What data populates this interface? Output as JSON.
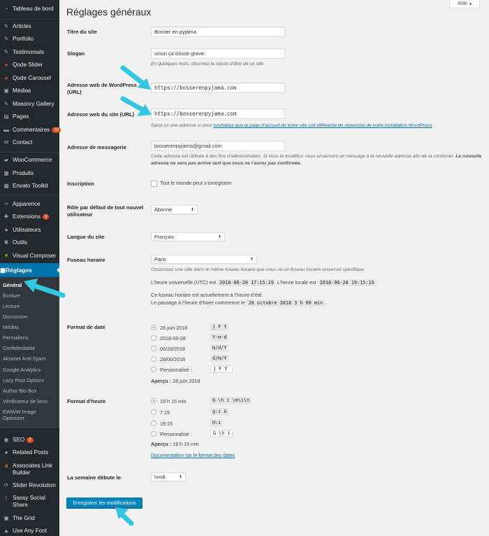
{
  "sidebar": {
    "items": [
      {
        "label": "Tableau de bord",
        "icon": "dashboard-icon",
        "glyph": "◔"
      },
      {
        "label": "Articles",
        "icon": "pin-icon",
        "glyph": "✎"
      },
      {
        "label": "Portfolio",
        "icon": "pin-icon",
        "glyph": "✎"
      },
      {
        "label": "Testimonials",
        "icon": "pin-icon",
        "glyph": "✎"
      },
      {
        "label": "Qode Slider",
        "icon": "qode-icon",
        "glyph": "●"
      },
      {
        "label": "Qode Carousel",
        "icon": "qode-icon",
        "glyph": "●"
      },
      {
        "label": "Médias",
        "icon": "media-icon",
        "glyph": "▣"
      },
      {
        "label": "Masonry Gallery",
        "icon": "pin-icon",
        "glyph": "✎"
      },
      {
        "label": "Pages",
        "icon": "pages-icon",
        "glyph": "▤"
      },
      {
        "label": "Commentaires",
        "icon": "comments-icon",
        "glyph": "▬",
        "badge": "10"
      },
      {
        "label": "Contact",
        "icon": "mail-icon",
        "glyph": "✉"
      },
      {
        "label": "WooCommerce",
        "icon": "woocommerce-icon",
        "glyph": "▰"
      },
      {
        "label": "Produits",
        "icon": "products-icon",
        "glyph": "▦"
      },
      {
        "label": "Envato Toolkit",
        "icon": "toolkit-icon",
        "glyph": "▦"
      },
      {
        "label": "Apparence",
        "icon": "appearance-icon",
        "glyph": "✑"
      },
      {
        "label": "Extensions",
        "icon": "plugins-icon",
        "glyph": "✚",
        "badge": "3"
      },
      {
        "label": "Utilisateurs",
        "icon": "users-icon",
        "glyph": "●"
      },
      {
        "label": "Outils",
        "icon": "tools-icon",
        "glyph": "✖"
      },
      {
        "label": "Visual Composer",
        "icon": "visual-composer-icon",
        "glyph": "▼"
      }
    ],
    "active": {
      "label": "Réglages",
      "icon": "settings-icon",
      "glyph": "▦"
    },
    "submenu": [
      "Général",
      "Écriture",
      "Lecture",
      "Discussion",
      "Médias",
      "Permaliens",
      "Confidentialité",
      "Akismet Anti-Spam",
      "Google Analytics",
      "Lazy Post Options",
      "Author Bio Box",
      "Vérificateur de liens",
      "EWWW Image Optimizer"
    ],
    "bottom_items": [
      {
        "label": "SEO",
        "icon": "seo-icon",
        "glyph": "◉",
        "badge": "3"
      },
      {
        "label": "Related Posts",
        "icon": "related-posts-icon",
        "glyph": "●"
      },
      {
        "label": "Associates Link Builder",
        "icon": "amazon-icon",
        "glyph": "a"
      },
      {
        "label": "Slider Revolution",
        "icon": "slider-icon",
        "glyph": "⟳"
      },
      {
        "label": "Sassy Social Share",
        "icon": "share-icon",
        "glyph": "⟨"
      },
      {
        "label": "The Grid",
        "icon": "grid-icon",
        "glyph": "▣"
      },
      {
        "label": "Use Any Font",
        "icon": "font-icon",
        "glyph": "▲"
      }
    ]
  },
  "header": {
    "title": "Réglages généraux",
    "help": "Aide"
  },
  "form": {
    "site_title": {
      "label": "Titre du site",
      "value": "Bosser en pyjama"
    },
    "tagline": {
      "label": "Slogan",
      "value": "sinon ça bosse grave",
      "desc": "En quelques mots, décrivez la raison d’être de ce site."
    },
    "wp_url": {
      "label": "Adresse web de WordPress (URL)",
      "value": "https://bosserenpyjama.com"
    },
    "site_url": {
      "label": "Adresse web du site (URL)",
      "value": "https://bosserenpyjama.com",
      "desc_pre": "Saisir ici une adresse si vous ",
      "desc_link": "souhaitez que la page d’accueil de votre site soit différente du répertoire de votre installation WordPress",
      "desc_post": "."
    },
    "admin_email": {
      "label": "Adresse de messagerie",
      "value": "bosserenpyjama@gmail.com",
      "desc": "Cette adresse est utilisée à des fins d’administration. Si vous la modifiez, nous enverrons un message à la nouvelle adresse afin de la confirmer.",
      "desc_bold": "La nouvelle adresse ne sera pas active tant que vous ne l’aurez pas confirmée."
    },
    "membership": {
      "label": "Inscription",
      "checkbox_label": "Tout le monde peut s’enregistrer"
    },
    "default_role": {
      "label": "Rôle par défaut de tout nouvel utilisateur",
      "value": "Abonné"
    },
    "language": {
      "label": "Langue du site",
      "value": "Français"
    },
    "timezone": {
      "label": "Fuseau horaire",
      "value": "Paris",
      "desc": "Choisissez une ville dans le même fuseau horaire que vous ou un fuseau horaire universel spécifique.",
      "utc_label": "L’heure universelle (UTC) est",
      "utc_value": "2018-06-28 17:15:19",
      "local_label": "L’heure locale est",
      "local_value": "2018-06-28 19:15:19",
      "dst_line1": "Ce fuseau horaire est actuellement à l’heure d’été.",
      "dst_line2": "Le passage à l’heure d’hiver commence le",
      "dst_value": "28 octobre 2018 3 h 00 min",
      "dst_end": "."
    },
    "date_format": {
      "label": "Format de date",
      "options": [
        {
          "label": "28 juin 2018",
          "code": "j F Y",
          "checked": true
        },
        {
          "label": "2018-06-28",
          "code": "Y-m-d",
          "checked": false
        },
        {
          "label": "06/28/2018",
          "code": "m/d/Y",
          "checked": false
        },
        {
          "label": "28/06/2018",
          "code": "d/m/Y",
          "checked": false
        }
      ],
      "custom_label": "Personnalisé :",
      "custom_value": "j F Y",
      "preview_label": "Aperçu :",
      "preview_value": "28 juin 2018"
    },
    "time_format": {
      "label": "Format d’heure",
      "options": [
        {
          "label": "19 h 15 min",
          "code": "G \\h i \\m\\i\\n",
          "checked": true
        },
        {
          "label": "7:15",
          "code": "g:i A",
          "checked": false
        },
        {
          "label": "19:15",
          "code": "H:i",
          "checked": false
        }
      ],
      "custom_label": "Personnalisé :",
      "custom_value": "G \\h i \\",
      "preview_label": "Aperçu :",
      "preview_value": "19 h 15 min",
      "doc_link": "Documentation sur le format des dates"
    },
    "start_of_week": {
      "label": "La semaine débute le",
      "value": "lundi"
    },
    "submit": "Enregistrer les modifications"
  },
  "colors": {
    "accent": "#0073aa",
    "sidebar": "#23282d",
    "annotation": "#33c6e0"
  }
}
